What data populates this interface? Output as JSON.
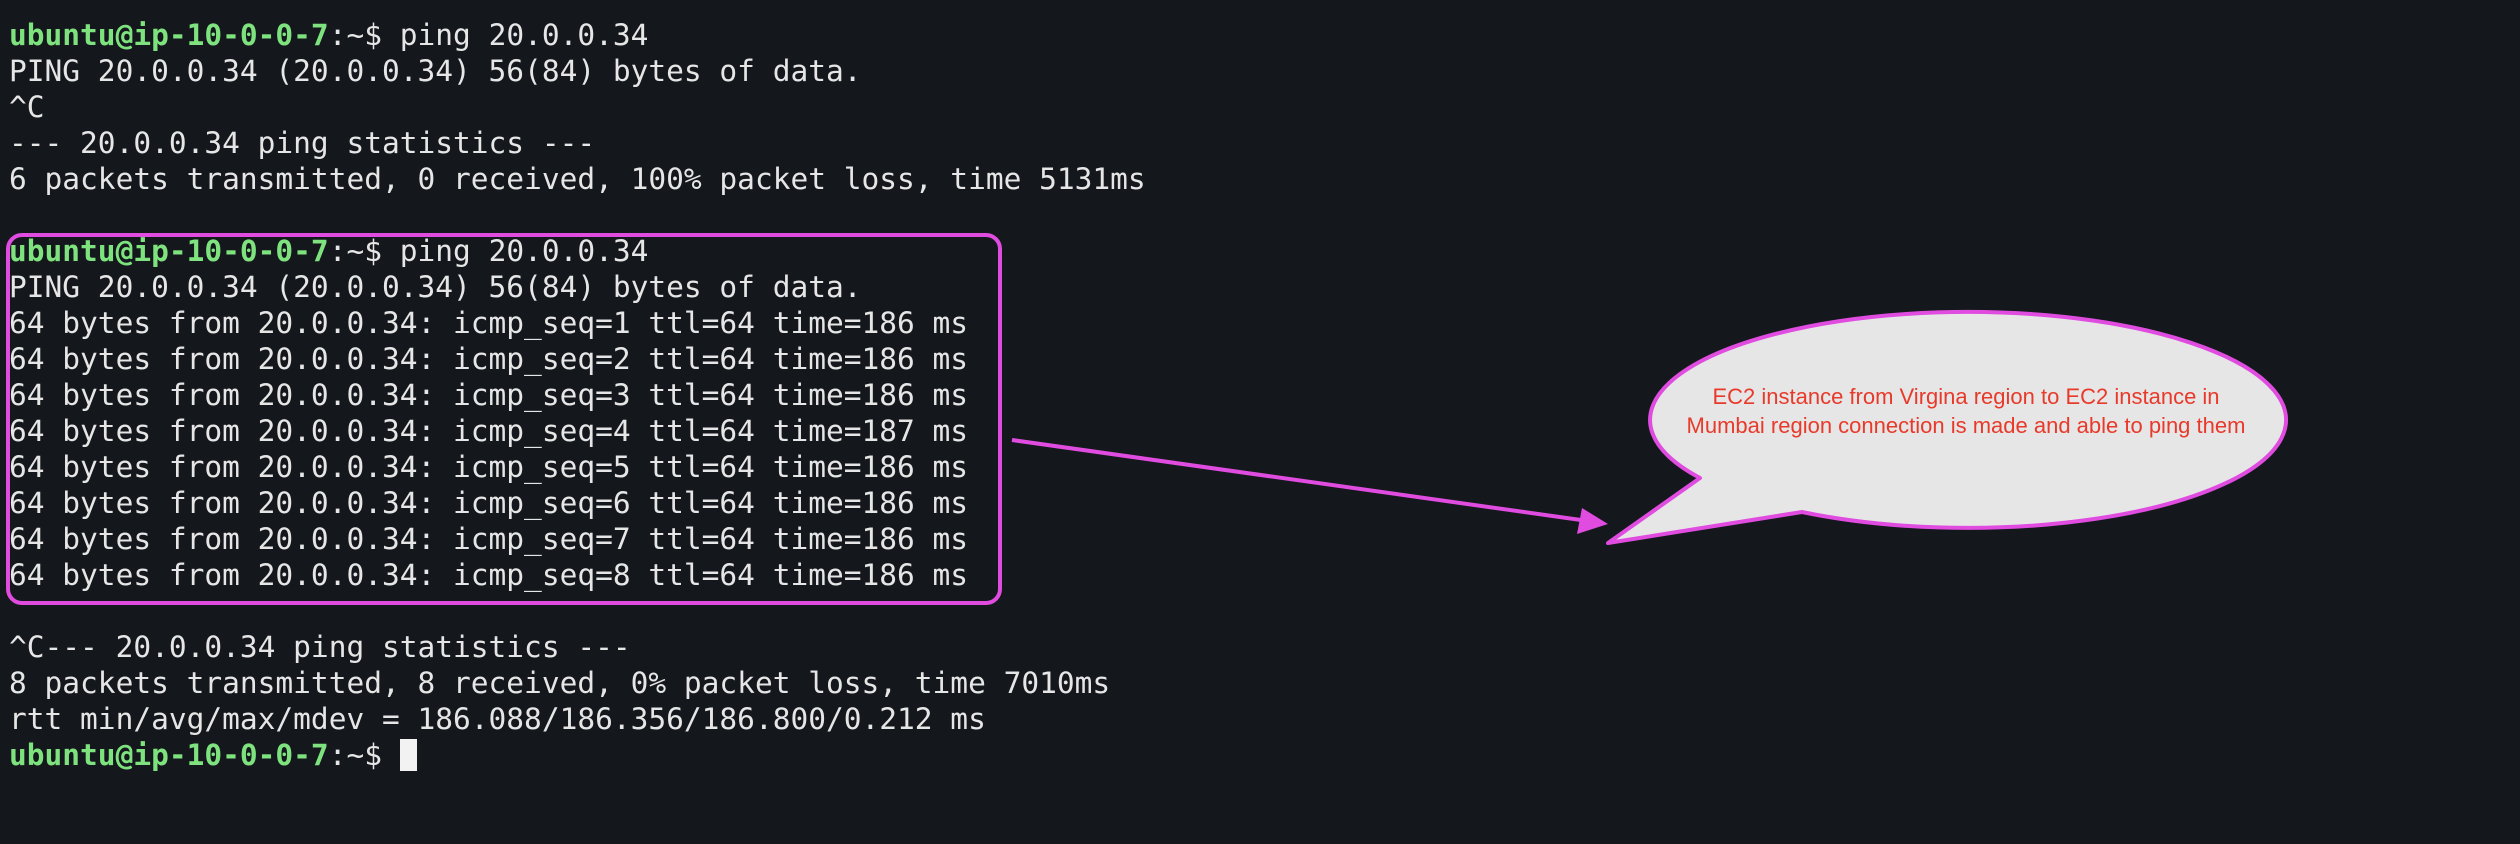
{
  "prompt": {
    "user_host": "ubuntu@ip-10-0-0-7",
    "path_symbol": ":~$"
  },
  "lines": [
    {
      "cmd": " ping 20.0.0.34"
    },
    {
      "text": "PING 20.0.0.34 (20.0.0.34) 56(84) bytes of data."
    },
    {
      "text": "^C"
    },
    {
      "text": "--- 20.0.0.34 ping statistics ---"
    },
    {
      "text": "6 packets transmitted, 0 received, 100% packet loss, time 5131ms"
    },
    {
      "cmd": " ping 20.0.0.34"
    },
    {
      "text": "PING 20.0.0.34 (20.0.0.34) 56(84) bytes of data."
    },
    {
      "text": "64 bytes from 20.0.0.34: icmp_seq=1 ttl=64 time=186 ms"
    },
    {
      "text": "64 bytes from 20.0.0.34: icmp_seq=2 ttl=64 time=186 ms"
    },
    {
      "text": "64 bytes from 20.0.0.34: icmp_seq=3 ttl=64 time=186 ms"
    },
    {
      "text": "64 bytes from 20.0.0.34: icmp_seq=4 ttl=64 time=187 ms"
    },
    {
      "text": "64 bytes from 20.0.0.34: icmp_seq=5 ttl=64 time=186 ms"
    },
    {
      "text": "64 bytes from 20.0.0.34: icmp_seq=6 ttl=64 time=186 ms"
    },
    {
      "text": "64 bytes from 20.0.0.34: icmp_seq=7 ttl=64 time=186 ms"
    },
    {
      "text": "64 bytes from 20.0.0.34: icmp_seq=8 ttl=64 time=186 ms"
    },
    {
      "text": "^C--- 20.0.0.34 ping statistics ---"
    },
    {
      "text": "8 packets transmitted, 8 received, 0% packet loss, time 7010ms"
    },
    {
      "text": "rtt min/avg/max/mdev = 186.088/186.356/186.800/0.212 ms"
    },
    {
      "cmd": " "
    }
  ],
  "annotation": {
    "line1": "EC2 instance from Virgina region to EC2 instance in",
    "line2": "Mumbai region connection is made and able to ping them"
  },
  "colors": {
    "background": "#14171c",
    "prompt": "#7ee37e",
    "text": "#e6e6e6",
    "highlight": "#e04ce0",
    "callout_fill": "#e6e6e6",
    "callout_text": "#e83a2a"
  }
}
